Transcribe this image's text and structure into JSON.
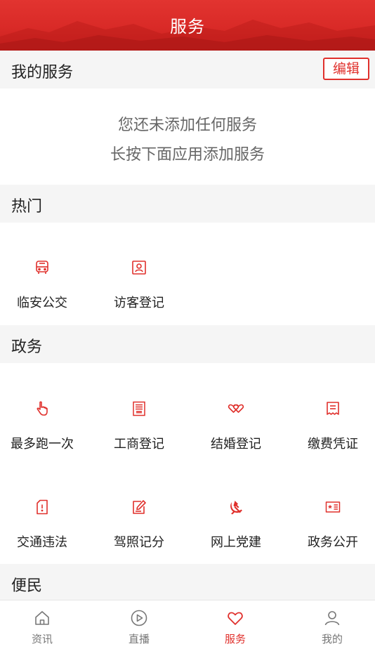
{
  "header": {
    "title": "服务"
  },
  "my_services": {
    "title": "我的服务",
    "edit_label": "编辑",
    "empty_line1": "您还未添加任何服务",
    "empty_line2": "长按下面应用添加服务"
  },
  "hot": {
    "title": "热门",
    "items": [
      {
        "label": "临安公交",
        "icon": "bus-icon"
      },
      {
        "label": "访客登记",
        "icon": "visitor-card-icon"
      }
    ]
  },
  "gov": {
    "title": "政务",
    "items": [
      {
        "label": "最多跑一次",
        "icon": "tap-hand-icon"
      },
      {
        "label": "工商登记",
        "icon": "business-doc-icon"
      },
      {
        "label": "结婚登记",
        "icon": "double-heart-icon"
      },
      {
        "label": "缴费凭证",
        "icon": "receipt-icon"
      },
      {
        "label": "交通违法",
        "icon": "warning-doc-icon"
      },
      {
        "label": "驾照记分",
        "icon": "edit-note-icon"
      },
      {
        "label": "网上党建",
        "icon": "party-emblem-icon"
      },
      {
        "label": "政务公开",
        "icon": "news-card-icon"
      }
    ]
  },
  "convenience": {
    "title": "便民"
  },
  "tabbar": {
    "items": [
      {
        "label": "资讯",
        "icon": "home-icon",
        "active": false
      },
      {
        "label": "直播",
        "icon": "play-icon",
        "active": false
      },
      {
        "label": "服务",
        "icon": "heart-icon",
        "active": true
      },
      {
        "label": "我的",
        "icon": "user-icon",
        "active": false
      }
    ]
  },
  "colors": {
    "accent": "#e0302c",
    "section_bg": "#f5f5f5"
  }
}
